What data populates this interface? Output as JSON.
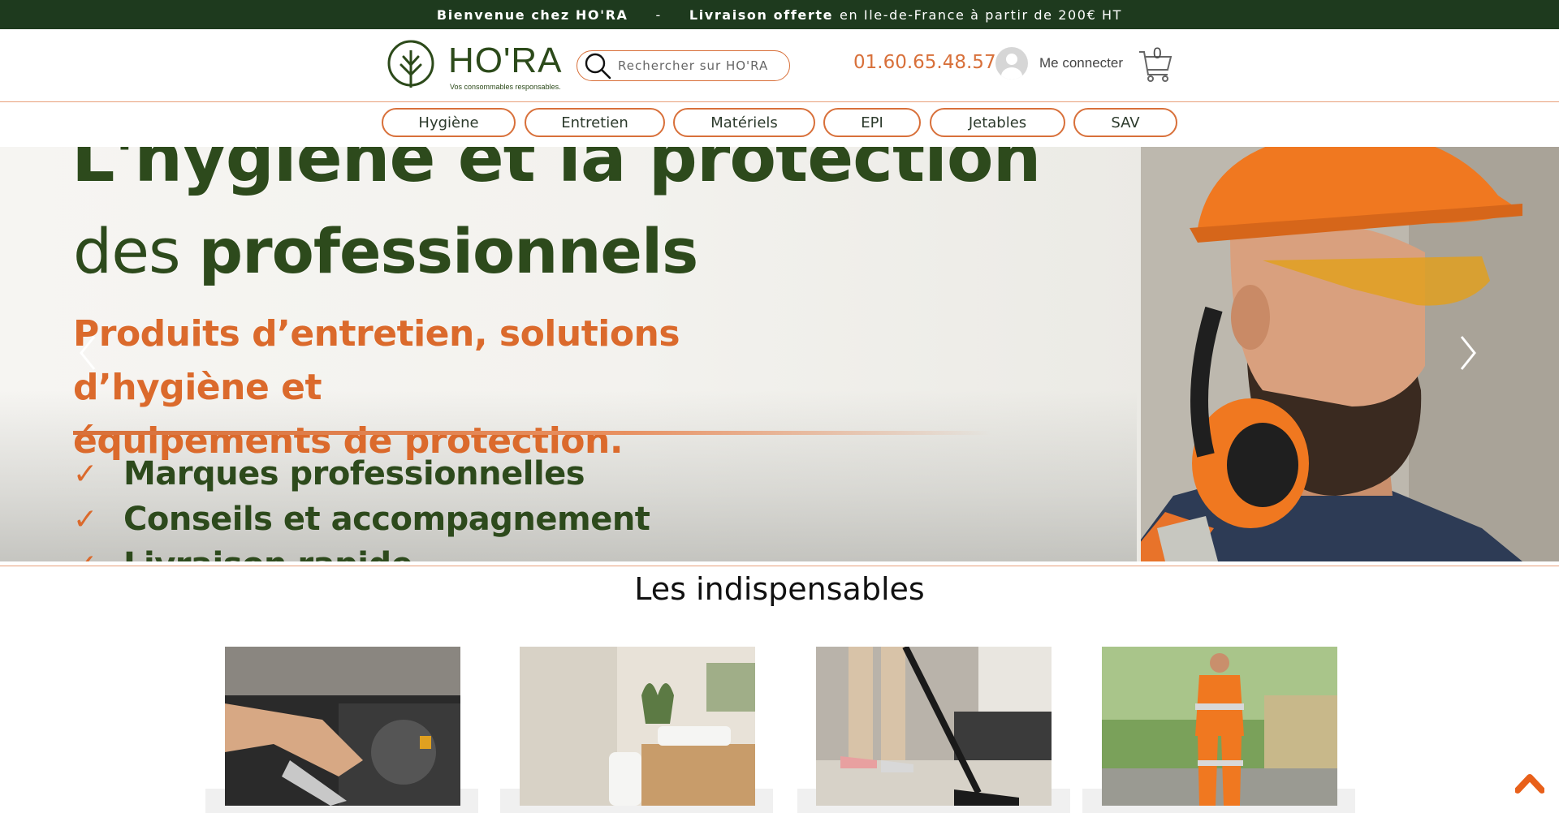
{
  "announcement": {
    "welcome": "Bienvenue chez HO'RA",
    "separator": "-",
    "delivery_strong": "Livraison offerte",
    "delivery_rest": "en Ile-de-France à partir de 200€ HT"
  },
  "header": {
    "logo_name": "HO'RA",
    "logo_tagline": "Vos consommables responsables.",
    "search_placeholder": "Rechercher sur HO'RA",
    "phone": "01.60.65.48.57",
    "login_label": "Me connecter",
    "cart_count": "0"
  },
  "nav": {
    "items": [
      {
        "label": "Hygiène"
      },
      {
        "label": "Entretien"
      },
      {
        "label": "Matériels"
      },
      {
        "label": "EPI"
      },
      {
        "label": "Jetables"
      },
      {
        "label": "SAV"
      }
    ]
  },
  "hero": {
    "title_line1": "L'hygiène et la protection",
    "title_line2_light": "des",
    "title_line2_bold": "professionnels",
    "subtitle_line1": "Produits d’entretien, solutions d’hygiène et",
    "subtitle_line2": "équipements de protection.",
    "checks": [
      {
        "mark": "✓",
        "label": "Marques professionnelles"
      },
      {
        "mark": "✓",
        "label": "Conseils et accompagnement"
      },
      {
        "mark": "✓",
        "label": "Livraison rapide"
      }
    ]
  },
  "section": {
    "title": "Les indispensables"
  },
  "colors": {
    "brand_green": "#1e3a1e",
    "accent_orange": "#d8703a",
    "title_green": "#2d4a1c"
  },
  "icons": {
    "search": "search-icon",
    "cart": "cart-icon",
    "avatar": "user-avatar-icon",
    "prev": "chevron-left-icon",
    "next": "chevron-right-icon",
    "scroll_top": "chevron-up-icon"
  }
}
